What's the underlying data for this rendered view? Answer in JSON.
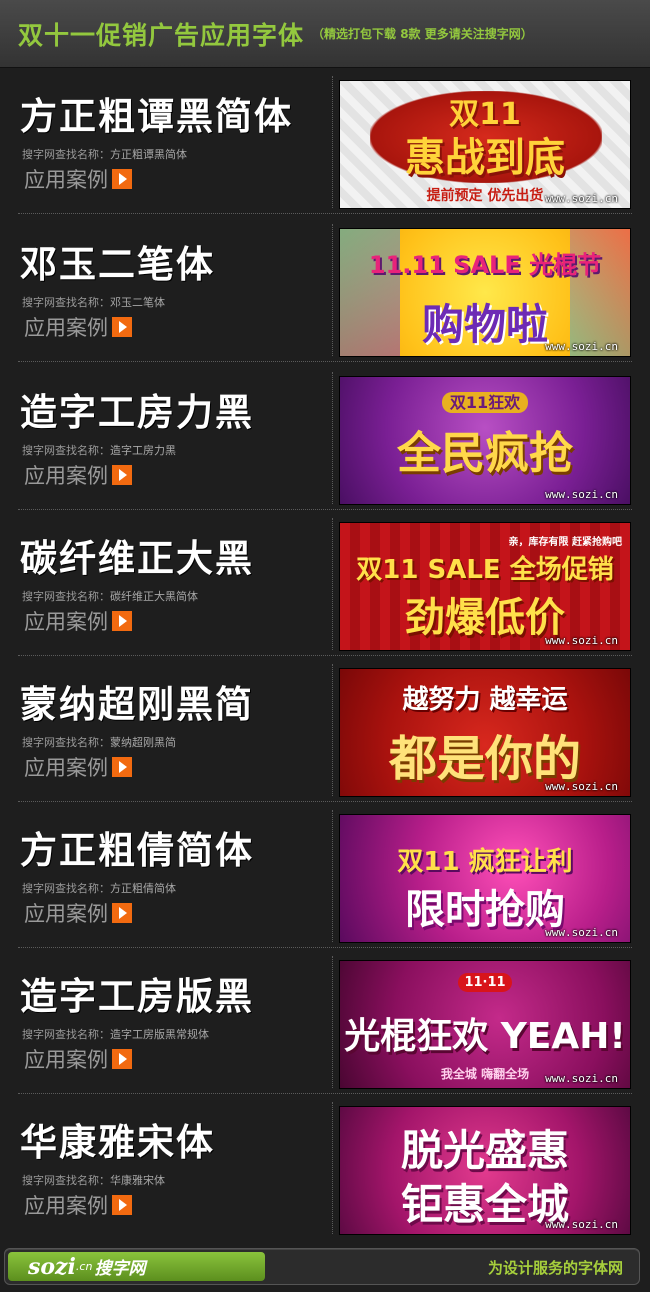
{
  "header": {
    "title": "双十一促销广告应用字体",
    "subtitle": "（精选打包下载  8款  更多请关注搜字网）"
  },
  "search_prefix": "搜字网查找名称：",
  "case_label": "应用案例",
  "watermark": "www.sozi.cn",
  "fonts": [
    {
      "name": "方正粗谭黑简体",
      "search_name": "方正粗谭黑简体",
      "banner": {
        "line1": "双11",
        "line2": "惠战到底",
        "line3": "提前预定    优先出货"
      }
    },
    {
      "name": "邓玉二笔体",
      "search_name": "邓玉二笔体",
      "banner": {
        "line1": "11.11 SALE 光棍节",
        "line2": "购物啦",
        "line3": ""
      }
    },
    {
      "name": "造字工房力黑",
      "search_name": "造字工房力黑",
      "banner": {
        "line1": "双11狂欢",
        "line2": "全民疯抢",
        "line3": ""
      }
    },
    {
      "name": "碳纤维正大黑",
      "search_name": "碳纤维正大黑简体",
      "banner": {
        "line1": "双11 SALE 全场促销",
        "line2": "劲爆低价",
        "line3": "亲，库存有限 赶紧抢购吧"
      }
    },
    {
      "name": "蒙纳超刚黑简",
      "search_name": "蒙纳超刚黑简",
      "banner": {
        "line1": "越努力 越幸运",
        "line2": "都是你的",
        "line3": ""
      }
    },
    {
      "name": "方正粗倩简体",
      "search_name": "方正粗倩简体",
      "banner": {
        "line1": "双11 疯狂让利",
        "line2": "限时抢购",
        "line3": ""
      }
    },
    {
      "name": "造字工房版黑",
      "search_name": "造字工房版黑常规体",
      "banner": {
        "line1": "11·11",
        "line2": "光棍狂欢 YEAH!",
        "line3": "我全城    嗨翻全场"
      }
    },
    {
      "name": "华康雅宋体",
      "search_name": "华康雅宋体",
      "banner": {
        "line1": "脱光盛惠",
        "line2": "钜惠全城",
        "line3": ""
      }
    }
  ],
  "footer": {
    "logo_main": "sozi",
    "logo_cn": ".cn",
    "logo_name": "搜字网",
    "slogan": "为设计服务的字体网"
  }
}
